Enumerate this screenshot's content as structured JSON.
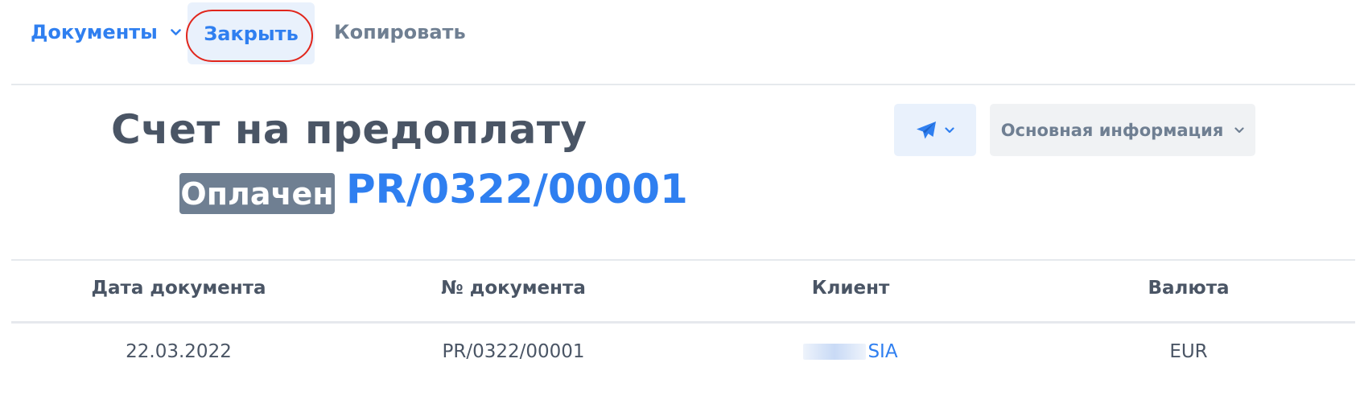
{
  "toolbar": {
    "documents_label": "Документы",
    "close_label": "Закрыть",
    "copy_label": "Копировать"
  },
  "header": {
    "title": "Счет на предоплату",
    "status": "Оплачен",
    "doc_number": "PR/0322/00001"
  },
  "actions": {
    "send_icon": "paper-plane-icon",
    "info_label": "Основная информация"
  },
  "table": {
    "headers": [
      "Дата документа",
      "№ документа",
      "Клиент",
      "Валюта"
    ],
    "row": {
      "date": "22.03.2022",
      "number": "PR/0322/00001",
      "client": "SIA",
      "currency": "EUR"
    }
  },
  "colors": {
    "accent": "#2f7ff0",
    "text": "#4a5565",
    "muted": "#6f7f92",
    "highlight_ring": "#e1261c"
  }
}
